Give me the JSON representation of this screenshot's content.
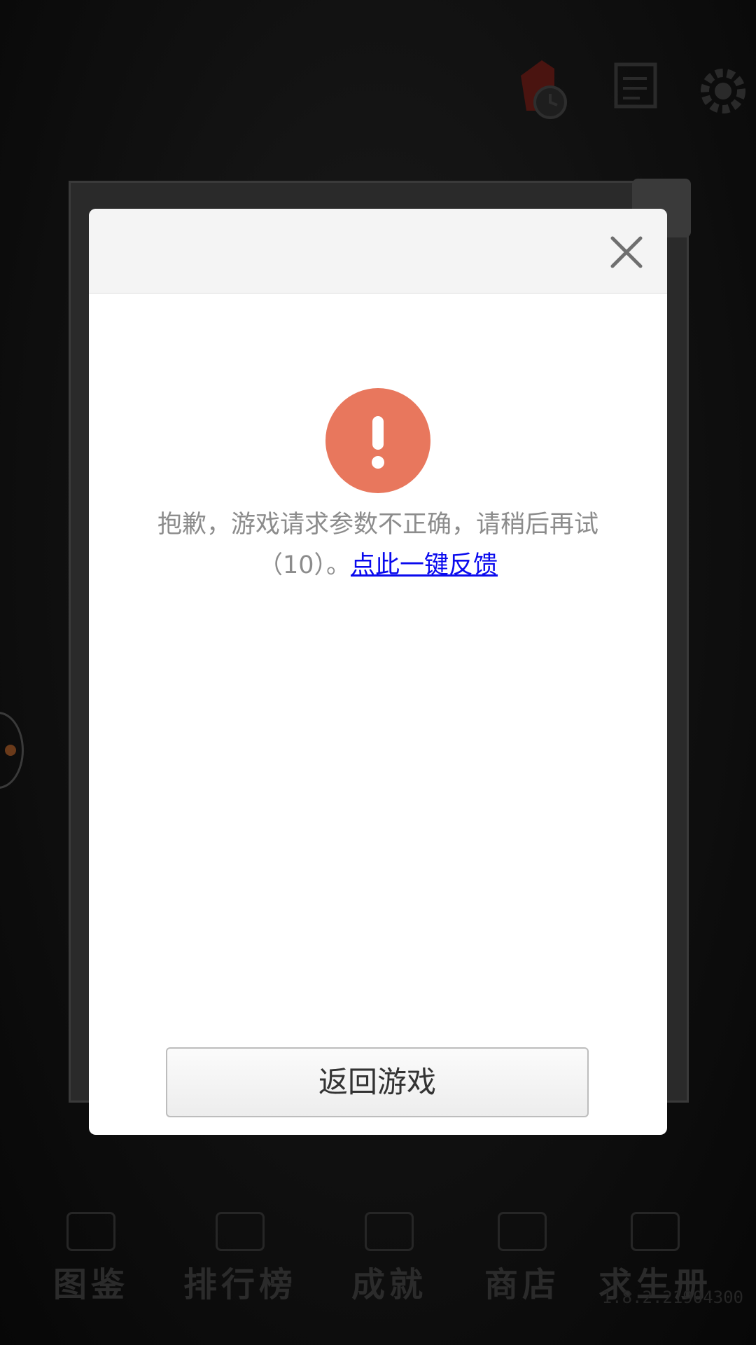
{
  "background": {
    "top_icons": [
      "price-tag-clock-icon",
      "scroll-quest-icon",
      "gear-icon"
    ],
    "panel_title": "",
    "bottom_nav": [
      {
        "icon": "book-icon",
        "label": "图鉴"
      },
      {
        "icon": "podium-icon",
        "label": "排行榜"
      },
      {
        "icon": "trophy-icon",
        "label": "成就"
      },
      {
        "icon": "cart-icon",
        "label": "商店"
      },
      {
        "icon": "notebook-icon",
        "label": "求生册"
      }
    ],
    "version": "1.8.2.21904300"
  },
  "dialog": {
    "close_icon": "close-icon",
    "alert_icon": "exclamation-icon",
    "alert_color": "#E8775D",
    "message_part1": "抱歉，游戏请求参数不正确，请稍后再试（10）。",
    "feedback_link": "点此一键反馈",
    "return_button": "返回游戏"
  }
}
